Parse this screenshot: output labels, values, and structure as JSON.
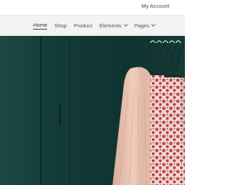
{
  "topbar": {
    "account_label": "My Account"
  },
  "nav": {
    "items": [
      {
        "label": "Home",
        "active": true
      },
      {
        "label": "Shop"
      },
      {
        "label": "Product"
      },
      {
        "label": "Elements",
        "dropdown": true
      },
      {
        "label": "Pages",
        "dropdown": true
      }
    ]
  },
  "hero": {
    "image": "clothes-rack-photo",
    "colors": {
      "wall": "#123a36",
      "garment_blush": "#e9c2ae",
      "floral": "#c2474d"
    }
  }
}
